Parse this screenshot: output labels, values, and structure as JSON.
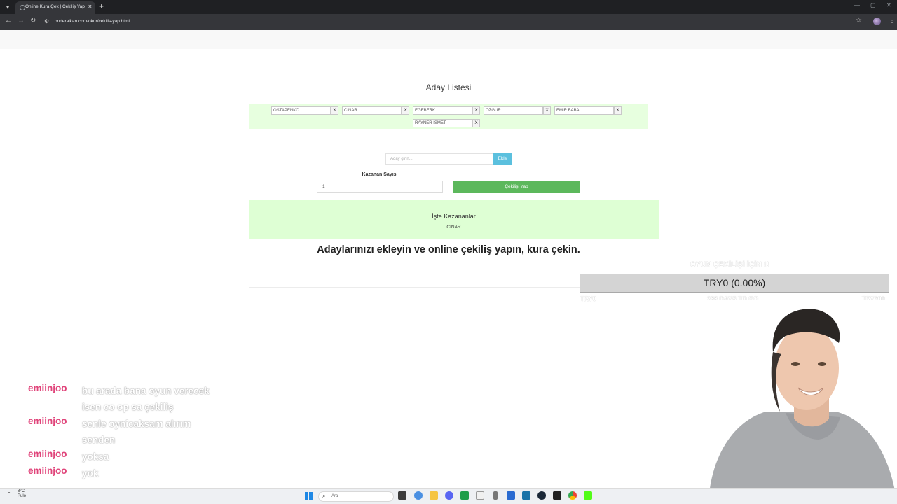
{
  "browser": {
    "tab_title": "Online Kura Çek | Çekiliş Yap",
    "url": "onderalkan.com/okur/cekilis-yap.html"
  },
  "page": {
    "list_title": "Aday Listesi",
    "candidates": [
      {
        "name": "OSTAPENKO",
        "remove": "X"
      },
      {
        "name": "CINAR",
        "remove": "X"
      },
      {
        "name": "EGEBERK",
        "remove": "X"
      },
      {
        "name": "OZGUR",
        "remove": "X"
      },
      {
        "name": "EMIR BABA",
        "remove": "X"
      },
      {
        "name": "RAYNER ISMET",
        "remove": "X"
      }
    ],
    "add_placeholder": "Aday girin...",
    "add_button": "Ekle",
    "winner_count_label": "Kazanan Sayısı",
    "winner_count_value": "1",
    "draw_button": "Çekilişi Yap",
    "winners_title": "İşte Kazananlar",
    "winner": "CINAR",
    "headline": "Adaylarınızı ekleyin ve online çekiliş yapın, kura çekin."
  },
  "goal": {
    "title": "OYUN ÇEKİLİŞİ İÇİN !!",
    "text": "TRY0 (0.00%)",
    "progress_fraction": 0.0,
    "current": "TRY0",
    "days_left": "288 DAYS TO GO",
    "target": "TRY200",
    "fill_color": "#4caf50"
  },
  "chat": [
    {
      "user": "emiinjoo",
      "text": "bu arada bana oyun verecek isen co op sa çekiliş"
    },
    {
      "user": "emiinjoo",
      "text": "senle oynicaksam alırım senden"
    },
    {
      "user": "emiinjoo",
      "text": "yoksa"
    },
    {
      "user": "emiinjoo",
      "text": "yok"
    }
  ],
  "taskbar": {
    "weather_temp": "8°C",
    "weather_desc": "Pulo",
    "search_placeholder": "Ara"
  },
  "colors": {
    "panel_green": "#e7ffdf",
    "add_button": "#5bc0de",
    "draw_button": "#5cb85c",
    "chat_user": "#e0447a"
  }
}
